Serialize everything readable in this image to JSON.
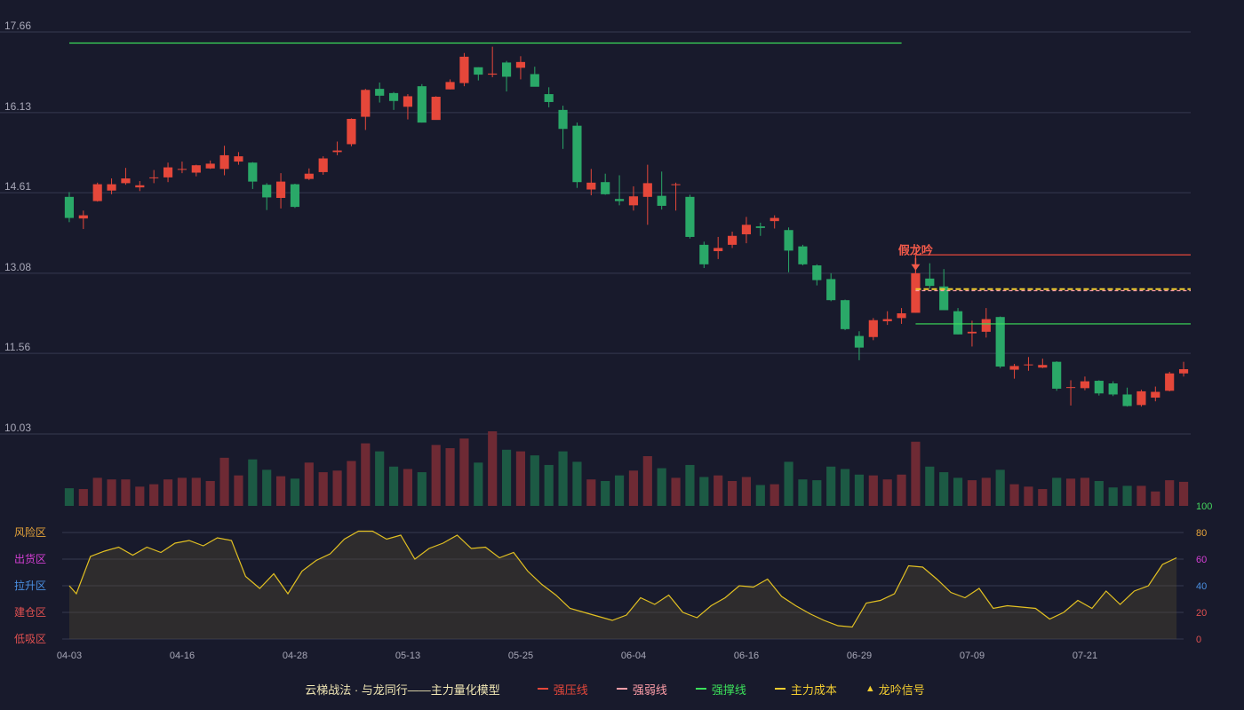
{
  "chart_data": {
    "type": "candlestick",
    "ylim": [
      9.6,
      17.9
    ],
    "y_ticks": [
      "17.66",
      "16.13",
      "14.61",
      "13.08",
      "11.56",
      "10.03"
    ],
    "x_ticks": [
      {
        "i": 0,
        "label": "04-03"
      },
      {
        "i": 8,
        "label": "04-16"
      },
      {
        "i": 16,
        "label": "04-28"
      },
      {
        "i": 24,
        "label": "05-13"
      },
      {
        "i": 32,
        "label": "05-25"
      },
      {
        "i": 40,
        "label": "06-04"
      },
      {
        "i": 48,
        "label": "06-16"
      },
      {
        "i": 56,
        "label": "06-29"
      },
      {
        "i": 64,
        "label": "07-09"
      },
      {
        "i": 72,
        "label": "07-21"
      }
    ],
    "candles": [
      [
        14.53,
        14.13,
        14.62,
        14.05
      ],
      [
        14.12,
        14.18,
        14.27,
        13.92
      ],
      [
        14.45,
        14.77,
        14.8,
        14.44
      ],
      [
        14.65,
        14.77,
        14.88,
        14.58
      ],
      [
        14.79,
        14.88,
        15.08,
        14.76
      ],
      [
        14.71,
        14.75,
        14.83,
        14.64
      ],
      [
        14.89,
        14.9,
        15.04,
        14.79
      ],
      [
        14.9,
        15.09,
        15.18,
        14.81
      ],
      [
        15.06,
        15.06,
        15.2,
        14.98
      ],
      [
        14.99,
        15.13,
        15.14,
        14.92
      ],
      [
        15.07,
        15.16,
        15.22,
        15.06
      ],
      [
        15.06,
        15.32,
        15.5,
        14.94
      ],
      [
        15.2,
        15.3,
        15.38,
        15.14
      ],
      [
        15.18,
        14.82,
        15.19,
        14.68
      ],
      [
        14.76,
        14.52,
        14.79,
        14.28
      ],
      [
        14.51,
        14.82,
        14.98,
        14.31
      ],
      [
        14.77,
        14.34,
        14.78,
        14.32
      ],
      [
        14.87,
        14.97,
        15.07,
        14.85
      ],
      [
        15.0,
        15.26,
        15.3,
        14.95
      ],
      [
        15.38,
        15.41,
        15.58,
        15.32
      ],
      [
        15.53,
        16.01,
        16.02,
        15.49
      ],
      [
        16.05,
        16.56,
        16.58,
        15.8
      ],
      [
        16.58,
        16.45,
        16.7,
        16.32
      ],
      [
        16.5,
        16.35,
        16.52,
        16.18
      ],
      [
        16.24,
        16.44,
        16.48,
        16.0
      ],
      [
        16.63,
        15.94,
        16.67,
        15.94
      ],
      [
        15.99,
        16.43,
        16.44,
        16.0
      ],
      [
        16.57,
        16.71,
        16.76,
        16.57
      ],
      [
        16.69,
        17.19,
        17.26,
        16.63
      ],
      [
        16.99,
        16.85,
        16.99,
        16.74
      ],
      [
        16.85,
        16.87,
        17.38,
        16.8
      ],
      [
        17.08,
        16.81,
        17.11,
        16.53
      ],
      [
        16.98,
        17.09,
        17.2,
        16.76
      ],
      [
        16.86,
        16.62,
        17.0,
        16.67
      ],
      [
        16.48,
        16.33,
        16.61,
        16.23
      ],
      [
        16.18,
        15.82,
        16.26,
        15.44
      ],
      [
        15.88,
        14.81,
        15.94,
        14.7
      ],
      [
        14.67,
        14.8,
        15.06,
        14.56
      ],
      [
        14.81,
        14.58,
        14.97,
        14.57
      ],
      [
        14.49,
        14.45,
        14.94,
        14.37
      ],
      [
        14.37,
        14.54,
        14.73,
        14.27
      ],
      [
        14.53,
        14.79,
        15.14,
        14.0
      ],
      [
        14.55,
        14.36,
        15.01,
        14.29
      ],
      [
        14.76,
        14.77,
        14.8,
        14.27
      ],
      [
        14.53,
        13.77,
        14.57,
        13.74
      ],
      [
        13.62,
        13.25,
        13.68,
        13.18
      ],
      [
        13.5,
        13.56,
        13.77,
        13.35
      ],
      [
        13.62,
        13.79,
        13.87,
        13.56
      ],
      [
        13.82,
        14.0,
        14.15,
        13.65
      ],
      [
        13.97,
        13.94,
        14.04,
        13.79
      ],
      [
        14.07,
        14.13,
        14.18,
        13.93
      ],
      [
        13.9,
        13.51,
        13.95,
        13.1
      ],
      [
        13.59,
        13.25,
        13.62,
        13.23
      ],
      [
        13.23,
        12.95,
        13.25,
        12.85
      ],
      [
        12.97,
        12.57,
        13.08,
        12.55
      ],
      [
        12.57,
        12.02,
        12.58,
        12.0
      ],
      [
        11.89,
        11.67,
        11.98,
        11.43
      ],
      [
        11.87,
        12.19,
        12.23,
        11.81
      ],
      [
        12.17,
        12.21,
        12.36,
        12.1
      ],
      [
        12.23,
        12.32,
        12.42,
        12.12
      ],
      [
        12.33,
        13.08,
        13.1,
        12.33
      ],
      [
        12.98,
        12.84,
        13.27,
        12.79
      ],
      [
        12.83,
        12.38,
        13.16,
        12.38
      ],
      [
        12.36,
        11.92,
        12.42,
        11.92
      ],
      [
        11.94,
        11.97,
        12.18,
        11.69
      ],
      [
        11.97,
        12.21,
        12.42,
        11.86
      ],
      [
        12.25,
        11.31,
        12.26,
        11.28
      ],
      [
        11.25,
        11.32,
        11.36,
        11.08
      ],
      [
        11.35,
        11.35,
        11.49,
        11.23
      ],
      [
        11.29,
        11.34,
        11.46,
        11.28
      ],
      [
        11.4,
        10.89,
        11.41,
        10.85
      ],
      [
        10.92,
        10.92,
        11.05,
        10.57
      ],
      [
        10.9,
        11.03,
        11.12,
        10.86
      ],
      [
        11.04,
        10.8,
        11.05,
        10.76
      ],
      [
        10.99,
        10.78,
        11.03,
        10.75
      ],
      [
        10.78,
        10.56,
        10.91,
        10.55
      ],
      [
        10.58,
        10.84,
        10.87,
        10.55
      ],
      [
        10.72,
        10.83,
        10.93,
        10.65
      ],
      [
        10.85,
        11.18,
        11.21,
        10.84
      ],
      [
        11.18,
        11.26,
        11.4,
        11.12
      ]
    ],
    "volume": [
      22,
      21,
      35,
      33,
      33,
      24,
      27,
      33,
      35,
      35,
      31,
      60,
      38,
      58,
      45,
      37,
      34,
      54,
      42,
      44,
      56,
      78,
      68,
      49,
      46,
      42,
      76,
      72,
      84,
      54,
      93,
      70,
      68,
      63,
      51,
      68,
      55,
      33,
      31,
      38,
      44,
      62,
      47,
      35,
      51,
      36,
      38,
      31,
      36,
      26,
      27,
      55,
      33,
      32,
      49,
      46,
      39,
      38,
      33,
      39,
      80,
      49,
      42,
      35,
      32,
      35,
      45,
      27,
      24,
      21,
      35,
      34,
      35,
      31,
      23,
      25,
      25,
      18,
      32,
      30
    ],
    "resistance_line": {
      "price": 13.43,
      "start": 60,
      "end": 79
    },
    "weak_line": {
      "price": 12.75,
      "start": 60,
      "end": 79
    },
    "support_line": {
      "price": 12.12,
      "start": 60,
      "end": 79
    },
    "top_line": {
      "price": 17.55,
      "start": 0,
      "end": 58
    },
    "main_cost_line": {
      "price": 12.78,
      "start": 60,
      "end": 79
    },
    "signal": {
      "i": 60,
      "label": "假龙吟"
    },
    "indicator": {
      "ylim": [
        0,
        100
      ],
      "y_ticks": [
        {
          "v": 100,
          "label": "100",
          "color": "#44d65e"
        },
        {
          "v": 80,
          "label": "80",
          "color": "#e6a43a"
        },
        {
          "v": 60,
          "label": "60",
          "color": "#d43fd4"
        },
        {
          "v": 40,
          "label": "40",
          "color": "#4a90e2"
        },
        {
          "v": 20,
          "label": "20",
          "color": "#e05050"
        },
        {
          "v": 0,
          "label": "0",
          "color": "#e05050"
        }
      ],
      "zones": [
        {
          "v": 80,
          "label": "风险区",
          "color": "#e6a43a"
        },
        {
          "v": 60,
          "label": "出货区",
          "color": "#d43fd4"
        },
        {
          "v": 40,
          "label": "拉升区",
          "color": "#4a90e2"
        },
        {
          "v": 20,
          "label": "建仓区",
          "color": "#e05050"
        },
        {
          "v": 0,
          "label": "低吸区",
          "color": "#e05050"
        }
      ],
      "values": [
        40,
        34,
        62,
        66,
        69,
        63,
        69,
        65,
        72,
        74,
        70,
        76,
        74,
        47,
        38,
        49,
        34,
        51,
        59,
        64,
        75,
        81,
        81,
        75,
        78,
        60,
        68,
        72,
        78,
        68,
        69,
        61,
        65,
        51,
        41,
        33,
        23,
        20,
        17,
        14,
        18,
        31,
        26,
        33,
        20,
        16,
        25,
        31,
        40,
        39,
        45,
        32,
        25,
        19,
        14,
        10,
        9,
        27,
        29,
        34,
        55,
        54,
        45,
        35,
        31,
        38,
        23,
        25,
        24,
        23,
        15,
        20,
        29,
        23,
        36,
        26,
        36,
        40,
        56,
        61
      ]
    },
    "colors": {
      "up": "#e5473a",
      "down": "#2aa868",
      "vol_up": "#6e2a34",
      "vol_down": "#1c5a44",
      "resistance": "#e5473a",
      "weak": "#ff9ea8",
      "support": "#3be05a",
      "cost": "#f2cc30",
      "indicator_line": "#e2c022",
      "signal": "#f25a4a",
      "grid": "#363950"
    }
  },
  "legend": {
    "title": "云梯战法 · 与龙同行——主力量化模型",
    "items": [
      {
        "label": "强压线",
        "color": "#e5473a",
        "style": "solid"
      },
      {
        "label": "强弱线",
        "color": "#ff9ea8",
        "style": "dashed"
      },
      {
        "label": "强撑线",
        "color": "#3be05a",
        "style": "solid"
      },
      {
        "label": "主力成本",
        "color": "#f2cc30",
        "style": "dashed"
      },
      {
        "label": "龙吟信号",
        "color": "#f2cc30",
        "style": "triangle"
      }
    ]
  }
}
